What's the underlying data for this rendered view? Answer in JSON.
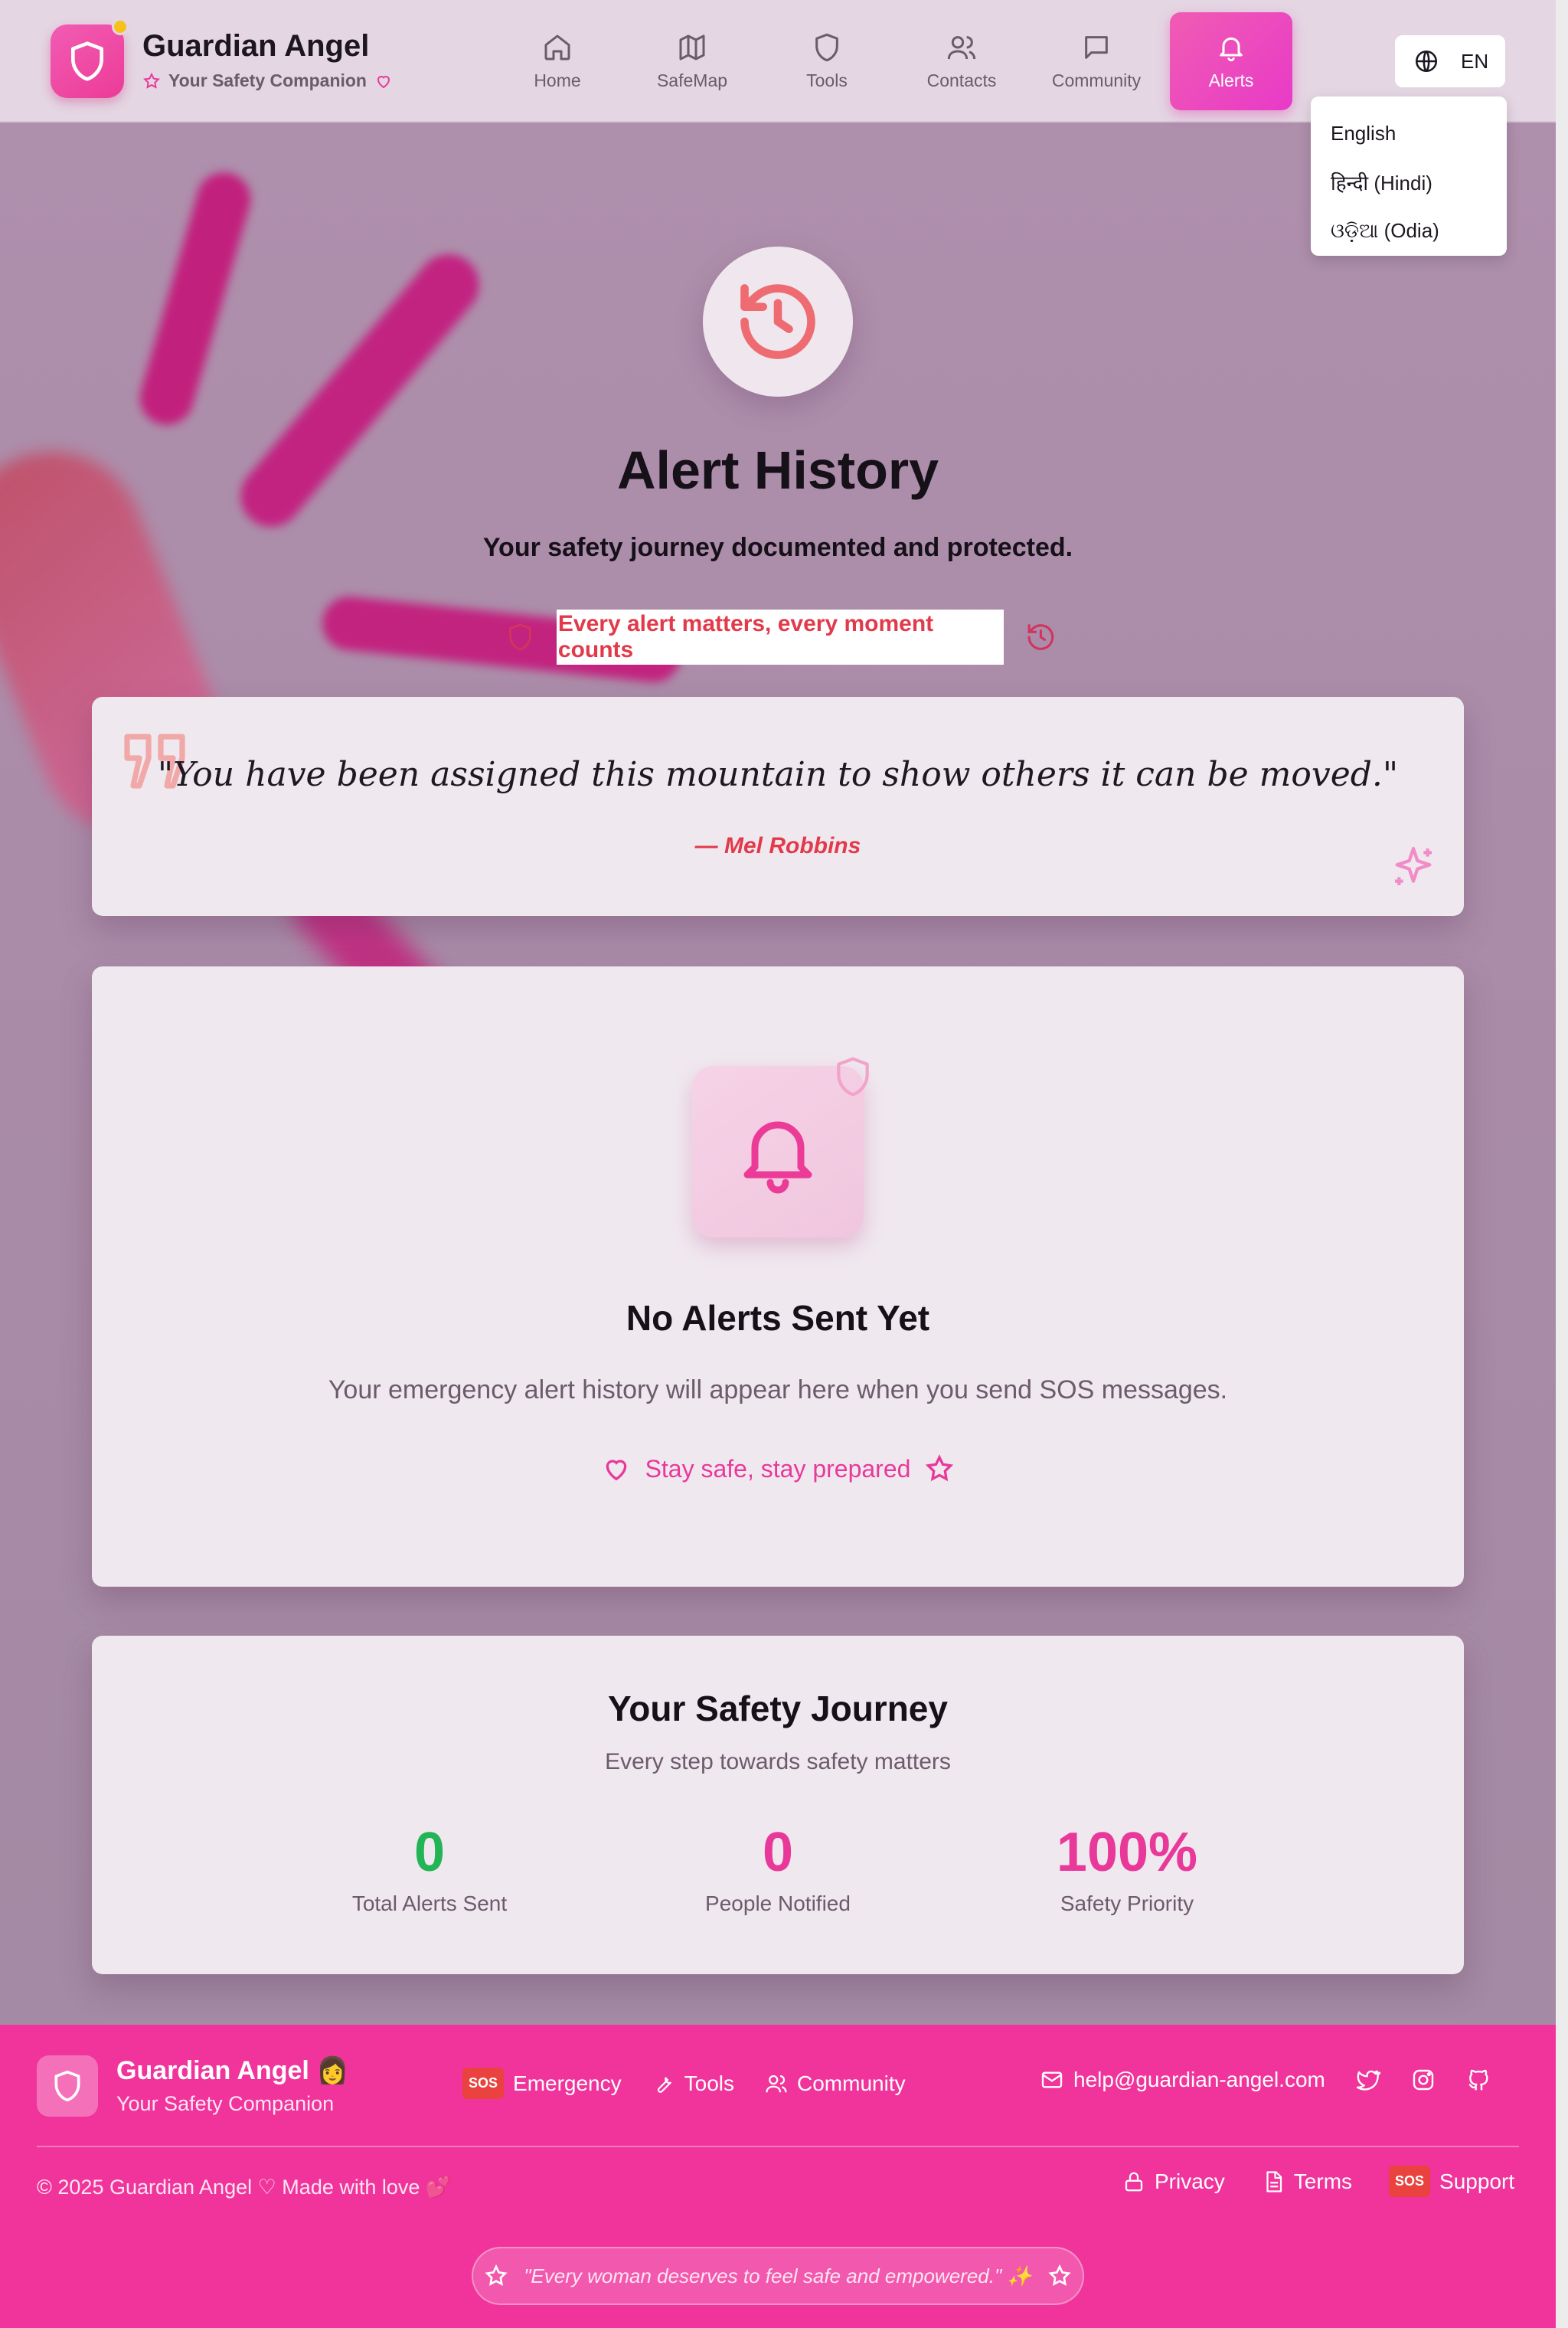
{
  "brand": {
    "title": "Guardian Angel",
    "subtitle": "Your Safety Companion"
  },
  "nav": [
    {
      "label": "Home",
      "icon": "home-icon"
    },
    {
      "label": "SafeMap",
      "icon": "map-icon"
    },
    {
      "label": "Tools",
      "icon": "shield-icon"
    },
    {
      "label": "Contacts",
      "icon": "users-icon"
    },
    {
      "label": "Community",
      "icon": "message-icon"
    },
    {
      "label": "Alerts",
      "icon": "bell-icon",
      "active": true
    }
  ],
  "language": {
    "current": "EN",
    "options": [
      "English",
      "हिन्दी (Hindi)",
      "ଓଡ଼ିଆ (Odia)"
    ]
  },
  "hero": {
    "title": "Alert History",
    "subtitle": "Your safety journey documented and protected.",
    "tagline": "Every alert matters, every moment counts"
  },
  "quote": {
    "text": "\"You have been assigned this mountain to show others it can be moved.\"",
    "author": "— Mel Robbins"
  },
  "empty_state": {
    "title": "No Alerts Sent Yet",
    "description": "Your emergency alert history will appear here when you send SOS messages.",
    "tagline": "Stay safe, stay prepared"
  },
  "journey": {
    "title": "Your Safety Journey",
    "subtitle": "Every step towards safety matters",
    "stats": [
      {
        "value": "0",
        "label": "Total Alerts Sent",
        "color": "#22b455"
      },
      {
        "value": "0",
        "label": "People Notified",
        "color": "#e8399a"
      },
      {
        "value": "100%",
        "label": "Safety Priority",
        "color": "#e8399a"
      }
    ]
  },
  "footer": {
    "title": "Guardian Angel 👩",
    "subtitle": "Your Safety Companion",
    "links": {
      "sos_badge": "SOS",
      "emergency": "Emergency",
      "tools": "Tools",
      "community": "Community"
    },
    "email": "help@guardian-angel.com",
    "copyright": "© 2025 Guardian Angel ♡ Made with love 💕",
    "legal": {
      "privacy": "Privacy",
      "terms": "Terms",
      "sos_badge": "SOS",
      "support": "Support"
    },
    "motto": "\"Every woman deserves to feel safe and empowered.\" ✨"
  },
  "colors": {
    "accent": "#e8399a",
    "footer": "#f0349b",
    "alert_red": "#e23a4a",
    "success": "#22b455"
  }
}
